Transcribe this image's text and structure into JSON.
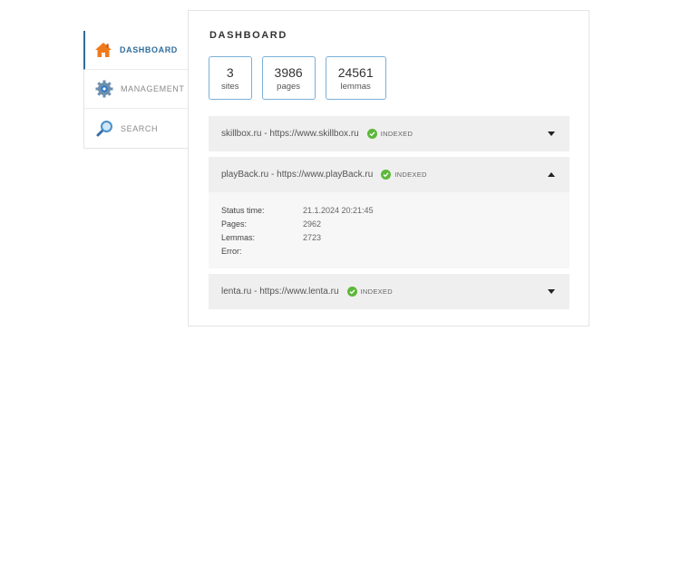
{
  "sidebar": {
    "items": [
      {
        "label": "DASHBOARD",
        "icon": "home-icon",
        "active": true
      },
      {
        "label": "MANAGEMENT",
        "icon": "gear-icon",
        "active": false
      },
      {
        "label": "SEARCH",
        "icon": "search-icon",
        "active": false
      }
    ]
  },
  "dashboard": {
    "title": "DASHBOARD",
    "stats": [
      {
        "value": "3",
        "label": "sites"
      },
      {
        "value": "3986",
        "label": "pages"
      },
      {
        "value": "24561",
        "label": "lemmas"
      }
    ],
    "sites": [
      {
        "title": "skillbox.ru - https://www.skillbox.ru",
        "status": "INDEXED",
        "expanded": false
      },
      {
        "title": "playBack.ru - https://www.playBack.ru",
        "status": "INDEXED",
        "expanded": true,
        "details": {
          "status_time_label": "Status time:",
          "status_time": "21.1.2024 20:21:45",
          "pages_label": "Pages:",
          "pages": "2962",
          "lemmas_label": "Lemmas:",
          "lemmas": "2723",
          "error_label": "Error:",
          "error": ""
        }
      },
      {
        "title": "lenta.ru - https://www.lenta.ru",
        "status": "INDEXED",
        "expanded": false
      }
    ]
  },
  "colors": {
    "accent": "#2f6d9c",
    "indexed": "#5db839",
    "stat_border": "#7ab0d8"
  }
}
